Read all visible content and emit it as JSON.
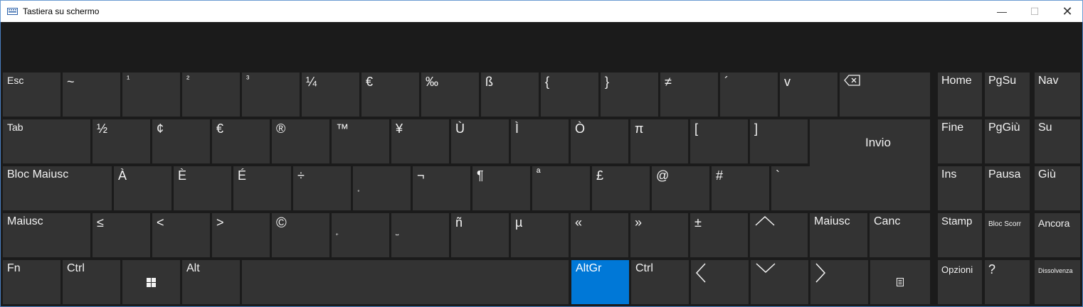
{
  "window": {
    "title": "Tastiera su schermo",
    "icon": "keyboard-icon",
    "min_glyph": "—",
    "max_glyph": "☐",
    "close_glyph": "✕"
  },
  "colors": {
    "key": "#333333",
    "background": "#1b1b1b",
    "accent": "#0078d7",
    "text": "#f2f2f2"
  },
  "rows": {
    "r1": [
      "Esc",
      "~",
      "¹",
      "²",
      "³",
      "¼",
      "€",
      "‰",
      "ß",
      "{",
      "}",
      "≠",
      "´",
      "v"
    ],
    "r1_backspace_icon": "backspace-icon",
    "r2": [
      "Tab",
      "½",
      "¢",
      "€",
      "®",
      "™",
      "¥",
      "Ù",
      "Ì",
      "Ò",
      "π",
      "[",
      "]",
      "Invio"
    ],
    "r3": [
      "Bloc Maiusc",
      "À",
      "È",
      "É",
      "÷",
      "˳",
      "¬",
      "¶",
      "ª",
      "£",
      "@",
      "#",
      "`"
    ],
    "r4": [
      "Maiusc",
      "≤",
      "<",
      ">",
      "©",
      "˿",
      "˽",
      "ñ",
      "µ",
      "«",
      "»",
      "±",
      "up-arrow-icon",
      "Maiusc",
      "Canc"
    ],
    "r5": [
      "Fn",
      "Ctrl",
      "windows-icon",
      "Alt",
      "",
      "AltGr",
      "Ctrl",
      "left-arrow-icon",
      "down-arrow-icon",
      "right-arrow-icon",
      "menu-icon"
    ]
  },
  "nav": {
    "r1": [
      "Home",
      "PgSu",
      "Nav"
    ],
    "r2": [
      "Fine",
      "PgGiù",
      "Su"
    ],
    "r3": [
      "Ins",
      "Pausa",
      "Giù"
    ],
    "r4": [
      "Stamp",
      "Bloc Scorr",
      "Ancora"
    ],
    "r5": [
      "Opzioni",
      "?",
      "Dissolvenza"
    ]
  }
}
